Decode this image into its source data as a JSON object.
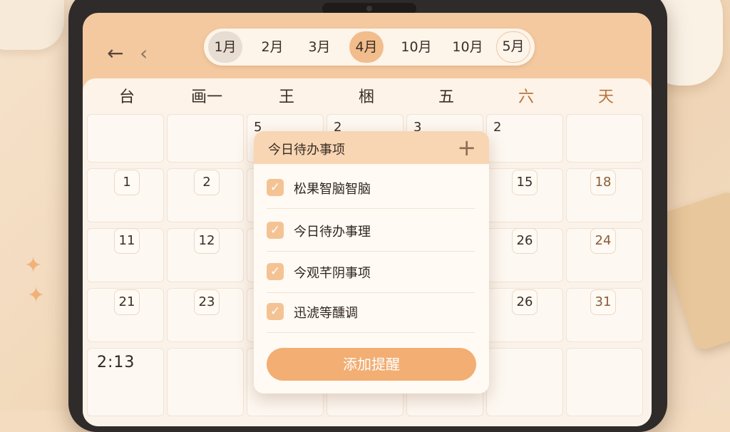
{
  "header": {
    "back_icon": "arrow-left-icon",
    "prev_icon": "chevron-left-icon",
    "months": [
      "1月",
      "2月",
      "3月",
      "4月",
      "10月",
      "10月",
      "5月"
    ],
    "active_month_index": 3
  },
  "weekdays": [
    "台",
    "画一",
    "王",
    "梱",
    "五",
    "六",
    "天"
  ],
  "grid": {
    "top_row_numbers": [
      "5",
      "2",
      "3",
      "2"
    ],
    "rows": [
      [
        "1",
        "2",
        "",
        "",
        "",
        "15",
        "18"
      ],
      [
        "11",
        "12",
        "",
        "",
        "",
        "26",
        "24"
      ],
      [
        "21",
        "23",
        "",
        "",
        "",
        "26",
        "31"
      ]
    ],
    "time": "2:13"
  },
  "todo": {
    "title": "今日待办事项",
    "add_icon": "plus-icon",
    "items": [
      {
        "label": "松果智脑智脑",
        "checked": true
      },
      {
        "label": "今日待办事理",
        "checked": true
      },
      {
        "label": "今观芊阴事项",
        "checked": true
      },
      {
        "label": "迅淲等醺调",
        "checked": true
      }
    ],
    "button_label": "添加提醒"
  },
  "colors": {
    "accent": "#f2ae73",
    "active_month": "#f2bd8c",
    "header_bg": "#f4c9a0"
  }
}
